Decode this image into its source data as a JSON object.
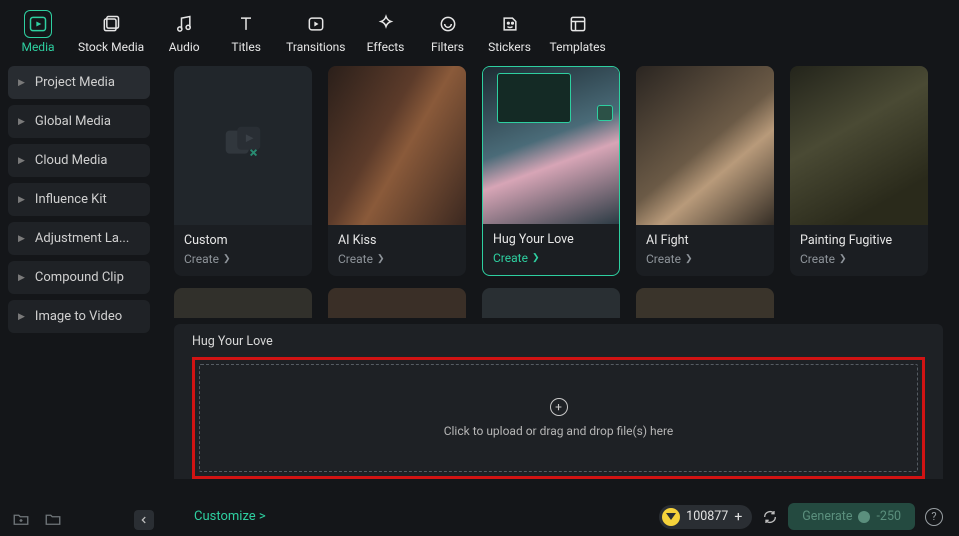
{
  "topnav": [
    {
      "id": "media",
      "label": "Media",
      "active": true
    },
    {
      "id": "stock",
      "label": "Stock Media"
    },
    {
      "id": "audio",
      "label": "Audio"
    },
    {
      "id": "titles",
      "label": "Titles"
    },
    {
      "id": "transitions",
      "label": "Transitions"
    },
    {
      "id": "effects",
      "label": "Effects"
    },
    {
      "id": "filters",
      "label": "Filters"
    },
    {
      "id": "stickers",
      "label": "Stickers"
    },
    {
      "id": "templates",
      "label": "Templates"
    }
  ],
  "sidebar": {
    "items": [
      {
        "label": "Project Media"
      },
      {
        "label": "Global Media"
      },
      {
        "label": "Cloud Media"
      },
      {
        "label": "Influence Kit"
      },
      {
        "label": "Adjustment La..."
      },
      {
        "label": "Compound Clip"
      },
      {
        "label": "Image to Video"
      }
    ]
  },
  "cards": [
    {
      "title": "Custom",
      "create": "Create",
      "kind": "custom"
    },
    {
      "title": "AI Kiss",
      "create": "Create",
      "kind": "kiss"
    },
    {
      "title": "Hug Your Love",
      "create": "Create",
      "kind": "hug",
      "selected": true
    },
    {
      "title": "AI Fight",
      "create": "Create",
      "kind": "fight"
    },
    {
      "title": "Painting Fugitive",
      "create": "Create",
      "kind": "paint"
    }
  ],
  "drop": {
    "title": "Hug Your Love",
    "text": "Click to upload or drag and drop file(s) here"
  },
  "bottom": {
    "customize": "Customize >",
    "credits": "100877",
    "generate_label": "Generate",
    "generate_cost": "-250"
  }
}
